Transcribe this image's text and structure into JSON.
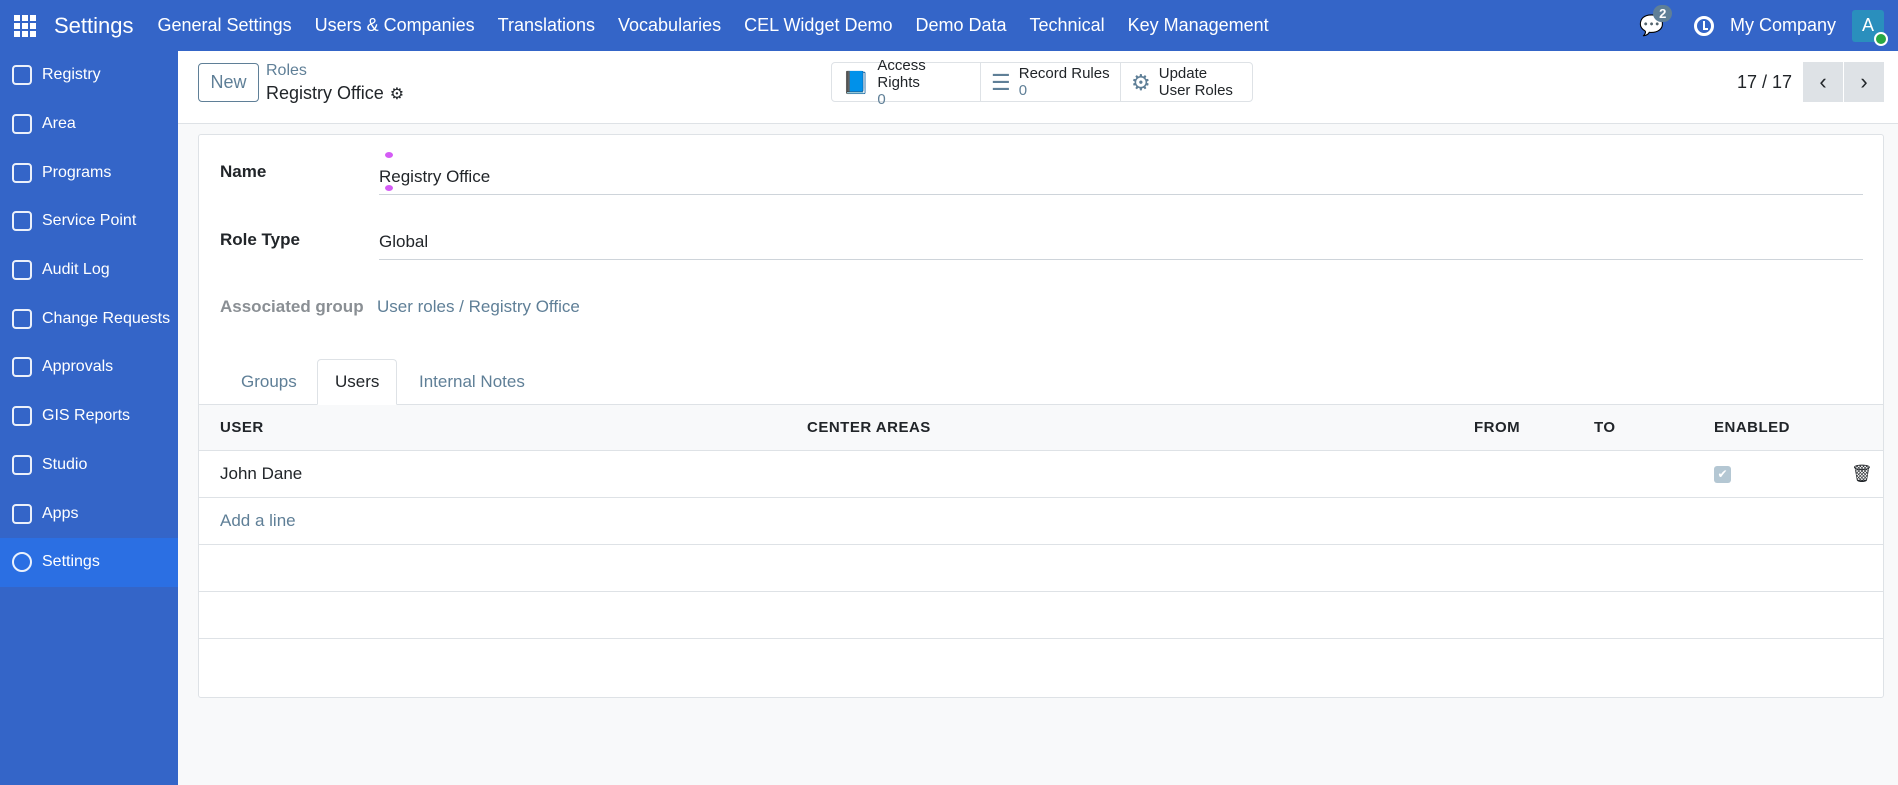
{
  "navbar": {
    "app": "Settings",
    "menus": [
      "General Settings",
      "Users & Companies",
      "Translations",
      "Vocabularies",
      "CEL Widget Demo",
      "Demo Data",
      "Technical",
      "Key Management"
    ],
    "chat_count": "2",
    "company": "My Company",
    "avatar_letter": "A"
  },
  "sidebar": {
    "items": [
      {
        "label": "Registry"
      },
      {
        "label": "Area"
      },
      {
        "label": "Programs"
      },
      {
        "label": "Service Point"
      },
      {
        "label": "Audit Log"
      },
      {
        "label": "Change Requests"
      },
      {
        "label": "Approvals"
      },
      {
        "label": "GIS Reports"
      },
      {
        "label": "Studio"
      },
      {
        "label": "Apps"
      },
      {
        "label": "Settings",
        "active": true
      }
    ]
  },
  "control": {
    "new_label": "New",
    "breadcrumb_parent": "Roles",
    "breadcrumb_current": "Registry Office",
    "smart_buttons": [
      {
        "label": "Access Rights",
        "value": "0"
      },
      {
        "label": "Record Rules",
        "value": "0"
      },
      {
        "label": "Update",
        "label2": "User Roles"
      }
    ],
    "pager": "17 / 17"
  },
  "form": {
    "name_label": "Name",
    "name_value": "Registry Office",
    "role_type_label": "Role Type",
    "role_type_value": "Global",
    "group_label": "Associated group",
    "group_value": "User roles / Registry Office"
  },
  "tabs": [
    "Groups",
    "Users",
    "Internal Notes"
  ],
  "table": {
    "headers": [
      "USER",
      "CENTER AREAS",
      "FROM",
      "TO",
      "ENABLED"
    ],
    "rows": [
      {
        "user": "John Dane",
        "center_areas": "",
        "from": "",
        "to": "",
        "enabled": true
      }
    ],
    "add_line": "Add a line"
  },
  "colors": {
    "brand": "#3465c8",
    "active": "#2b6fe3",
    "muted": "#5f7f97"
  }
}
